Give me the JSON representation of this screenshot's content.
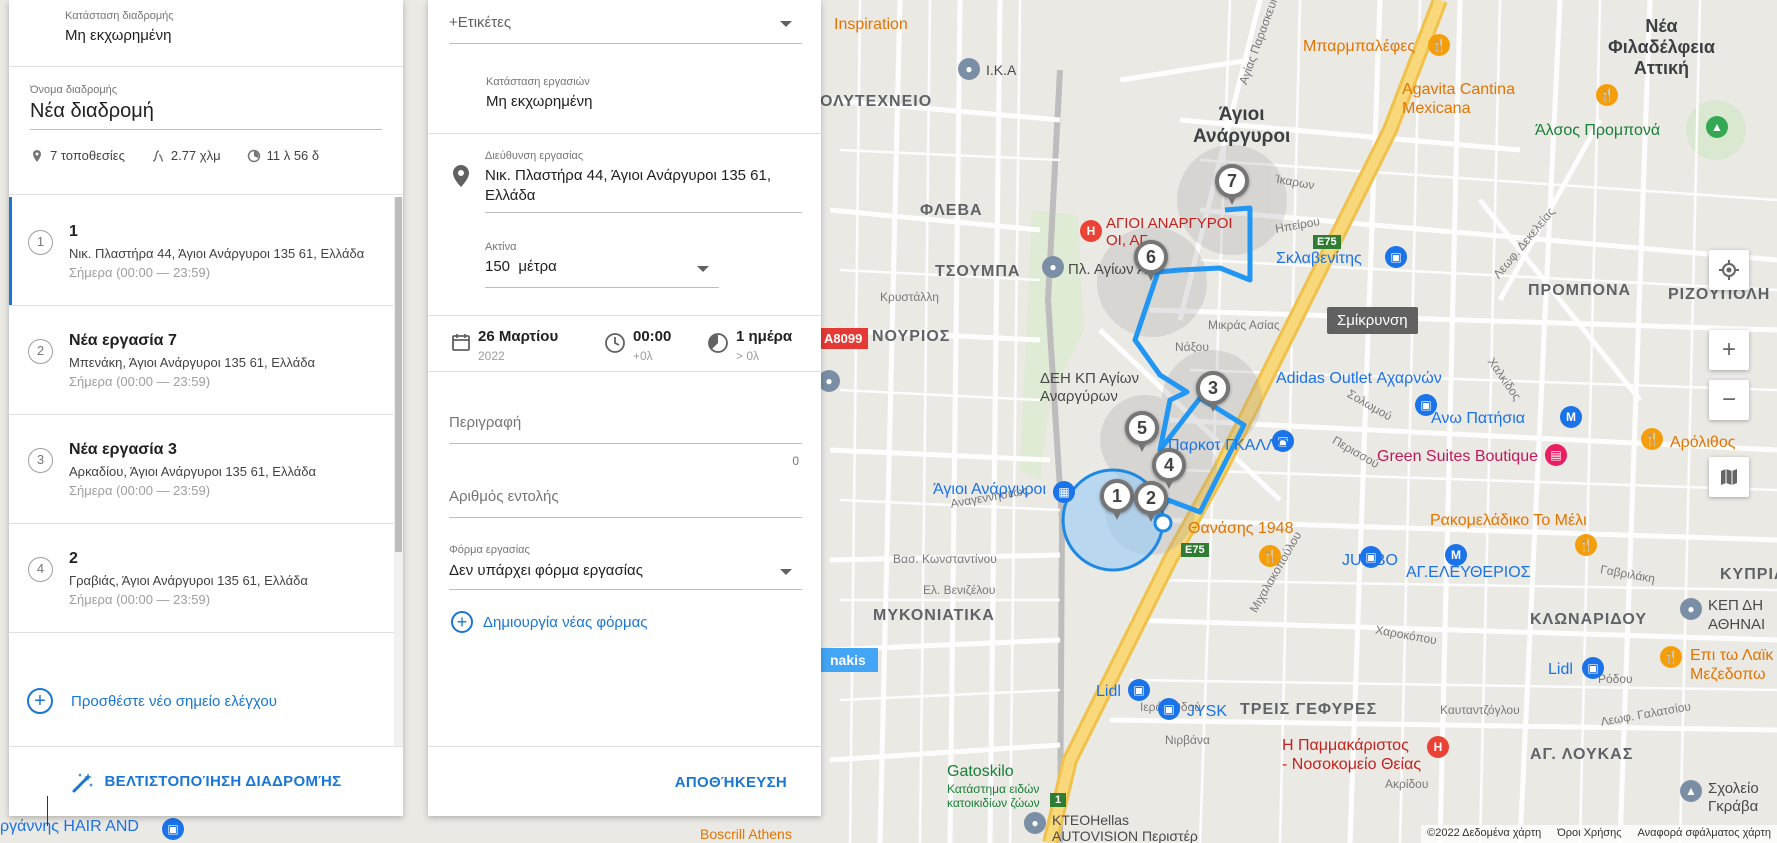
{
  "left_panel": {
    "route_status_label": "Κατάσταση διαδρομής",
    "route_status_value": "Μη εκχωρημένη",
    "route_name_label": "Όνομα διαδρομής",
    "route_name_value": "Νέα διαδρομή",
    "stats": {
      "locations": "7  τοποθεσίες",
      "distance": "2.77 χλμ",
      "duration": "11 λ 56 δ"
    },
    "stops": [
      {
        "number": "1",
        "title": "1",
        "address": "Νικ. Πλαστήρα 44, Άγιοι Ανάργυροι 135 61, Ελλάδα",
        "time": "Σήμερα (00:00 — 23:59)"
      },
      {
        "number": "2",
        "title": "Νέα εργασία 7",
        "address": "Μπενάκη, Άγιοι Ανάργυροι 135 61, Ελλάδα",
        "time": "Σήμερα (00:00 — 23:59)"
      },
      {
        "number": "3",
        "title": "Νέα εργασία 3",
        "address": "Αρκαδίου, Άγιοι Ανάργυροι 135 61, Ελλάδα",
        "time": "Σήμερα (00:00 — 23:59)"
      },
      {
        "number": "4",
        "title": "2",
        "address": "Γραβιάς, Άγιοι Ανάργυροι 135 61, Ελλάδα",
        "time": "Σήμερα (00:00 — 23:59)"
      }
    ],
    "add_checkpoint": "Προσθέστε νέο σημείο ελέγχου",
    "optimize_button": "ΒΕΛΤΙΣΤΟΠΟΊΗΣΗ ΔΙΑΔΡΟΜΉΣ"
  },
  "task_panel": {
    "tags_placeholder": "+Ετικέτες",
    "task_status_label": "Κατάσταση εργασιών",
    "task_status_value": "Μη εκχωρημένη",
    "address_label": "Διεύθυνση εργασίας",
    "address_value": "Νικ. Πλαστήρα 44, Άγιοι Ανάργυροι 135 61, Ελλάδα",
    "radius_label": "Ακτίνα",
    "radius_value": "150",
    "radius_unit": "μέτρα",
    "date_main": "26 Μαρτίου",
    "date_sub": "2022",
    "time_main": "00:00",
    "time_sub": "+0λ",
    "duration_main": "1  ημέρα",
    "duration_sub": "> 0λ",
    "description_placeholder": "Περιγραφή",
    "description_counter": "0",
    "order_number_placeholder": "Αριθμός εντολής",
    "form_label": "Φόρμα εργασίας",
    "form_value": "Δεν υπάρχει φόρμα εργασίας",
    "create_form": "Δημιουργία νέας φόρμας",
    "save_button": "ΑΠΟΘΉΚΕΥΣΗ"
  },
  "map": {
    "tooltip": "Σμίκρυνση",
    "markers": [
      "1",
      "2",
      "3",
      "4",
      "5",
      "6",
      "7"
    ],
    "areas": {
      "nea_filadelfeia": "Νέα\nΦιλαδέλφεια\nΑττική",
      "agioi_anargyroi": "Άγιοι\nΑνάργυροι",
      "polytechneio": "ΟΛΥΤΕΧΝΕΙΟ",
      "fleva": "ΦΛΕΒΑ",
      "tsoumpa": "ΤΣΟΥΜΠΑ",
      "anourios": "ΝΟΥΡΙΟΣ",
      "promponas": "ΠΡΟΜΠΟΝΑ",
      "rizoupoli": "ΡΙΖΟΥΠΟΛΗ",
      "mykoniatika": "ΜΥΚΟΝΙΑΤΙΚΑ",
      "treis_gefyres": "ΤΡΕΙΣ ΓΕΦΥΡΕΣ",
      "klonaridou": "ΚΛΩΝΑΡΙΔΟΥ",
      "ag_loukas": "ΑΓ. ΛΟΥΚΑΣ",
      "kyprou": "ΚΥΠΡΙΑΔ"
    },
    "pois": {
      "inspiration": "Inspiration",
      "mparmpalefes": "Μπαρμπαλέφες",
      "ika": "Ι.Κ.Α",
      "agavita": "Agavita Cantina\nMexicana",
      "alsos": "Άλσος Προμπονά",
      "hospital": "ΑΓΙΟΙ ΑΝΑΡΓΥΡΟΙ\nΟΙ, ΑΓ",
      "plateia": "Πλ. Αγίων Αν",
      "sklavenitis": "Σκλαβενίτης",
      "deh": "ΔΕΗ ΚΠ Αγίων\nΑναργύρων",
      "adidas": "Adidas Outlet Αχαρνών",
      "ano_patisia": "Άνω Πατήσια",
      "arolithos": "Αρόλιθος",
      "green_suites": "Green Suites Boutique",
      "agioi_station": "Άγιοι Ανάργυροι",
      "gkallo": "Παρκοτ ΓΚΑΛΛΟ",
      "thanasis": "Θανάσης 1948",
      "jumbo": "JUMBO",
      "ag_eleftherios": "ΑΓ.ΕΛΕΥΘΕΡΙΟΣ",
      "rakomeladiko": "Ρακομελάδικο Το Μέλι",
      "kep": "ΚΕΠ ΔΗ\nΑΘΗΝΑΙ",
      "lidl_right": "Lidl",
      "epi_tw": "Επι τω Λαϊκ\nΜεζεδοπω",
      "lidl": "Lidl",
      "jysk": "JYSK",
      "gatoskilo": "Gatoskilo",
      "gatoskilo_sub": "Κατάστημα ειδών\nκατοικιδίων ζώων",
      "pammakaristos": "Η Παμμακάριστος\n- Νοσοκομείο Θείας",
      "ktel": "ΚΤΕΟHellas\nAUTOVISION Περιστέρ",
      "sxoleio": "Σχολείο\nΓκράβα",
      "hair": "ργάννης HAIR AND",
      "nakis": "nakis",
      "a8099": "A8099",
      "e75_a": "E75",
      "e75_b": "E75",
      "one": "1",
      "souvlaki": "Boscrill Athens"
    },
    "streets": {
      "s1": "Λεωφ. Δεκελείας",
      "s2": "Λεωφ. Γαλατσίου",
      "s3": "Χαλκίδος",
      "s4": "Καυταντζόγλου",
      "s5": "Βασ. Κωνσταντίνου",
      "s6": "Ελ. Βενιζέλου",
      "s7": "Μιχαλακοπούλου",
      "s8": "Χαροκόπου",
      "s9": "Ιεράς Οδού",
      "s10": "Πειραιώς",
      "s11": "Μικράς Ασίας",
      "s12": "Νάξου",
      "s13": "Κρυστάλλη",
      "s14": "Αγίας Παρασκευής",
      "s15": "Σολωμού",
      "s16": "Περισσού",
      "s17": "Νιρβάνα",
      "s18": "Ακρίδου",
      "s19": "Αναγεννήσεως",
      "s20": "Ίκαρων",
      "s21": "Ηπείρου",
      "s22": "Γαβριλάκη",
      "s23": "Ρόδου"
    },
    "attribution": [
      "©2022 Δεδομένα χάρτη",
      "Όροι Χρήσης",
      "Αναφορά σφάλματος χάρτη"
    ],
    "colors": {
      "route": "#2196f3",
      "accent": "#1976d2",
      "highway": "#f6cf65"
    }
  }
}
